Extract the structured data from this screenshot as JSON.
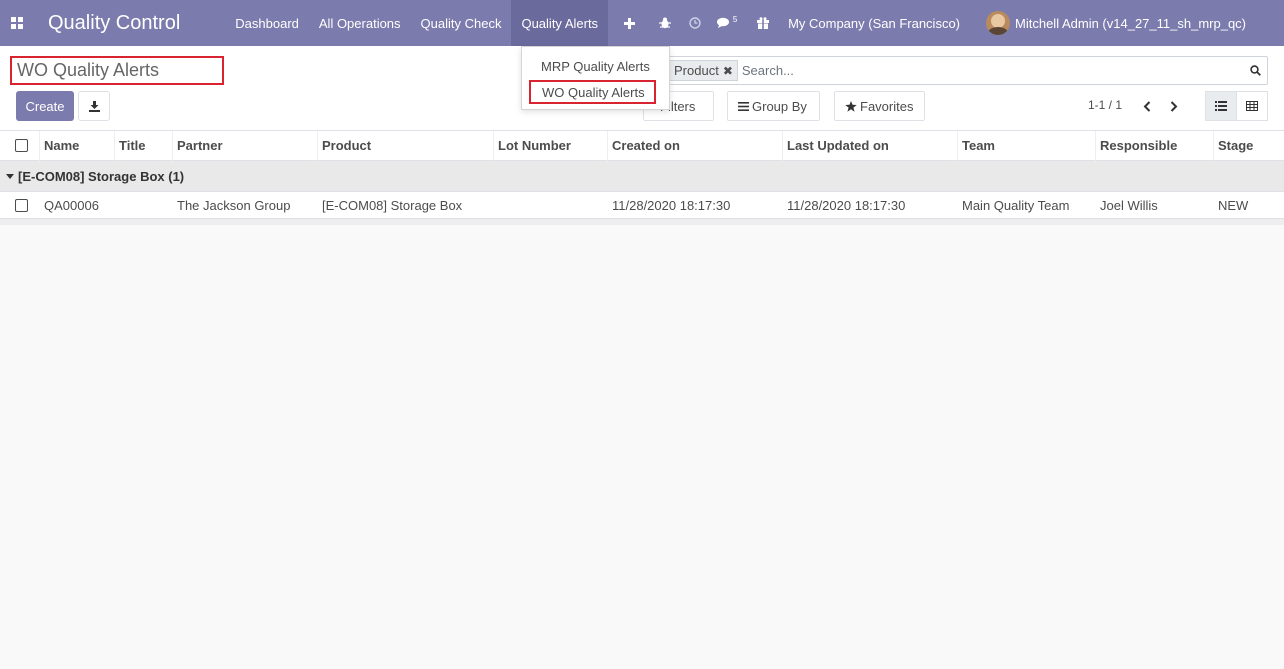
{
  "navbar": {
    "app_title": "Quality Control",
    "menu": [
      {
        "label": "Dashboard"
      },
      {
        "label": "All Operations"
      },
      {
        "label": "Quality Check"
      },
      {
        "label": "Quality Alerts"
      }
    ],
    "messages_count": "5",
    "company": "My Company (San Francisco)",
    "user": "Mitchell Admin (v14_27_11_sh_mrp_qc)",
    "bg_color": "#7c7bad"
  },
  "dropdown": {
    "items": [
      {
        "label": "MRP Quality Alerts"
      },
      {
        "label": "WO Quality Alerts"
      }
    ]
  },
  "control_panel": {
    "breadcrumb": "WO Quality Alerts",
    "create_label": "Create",
    "facet_label": "Product",
    "search_placeholder": "Search...",
    "filters_label": "Filters",
    "groupby_label": "Group By",
    "favorites_label": "Favorites",
    "pager": "1-1 / 1"
  },
  "table": {
    "columns": [
      "Name",
      "Title",
      "Partner",
      "Product",
      "Lot Number",
      "Created on",
      "Last Updated on",
      "Team",
      "Responsible",
      "Stage"
    ],
    "group": {
      "label": "[E-COM08] Storage Box (1)"
    },
    "rows": [
      {
        "name": "QA00006",
        "title": "",
        "partner": "The Jackson Group",
        "product": "[E-COM08] Storage Box",
        "lot": "",
        "created": "11/28/2020 18:17:30",
        "updated": "11/28/2020 18:17:30",
        "team": "Main Quality Team",
        "responsible": "Joel Willis",
        "stage": "NEW"
      }
    ]
  },
  "colors": {
    "accent": "#7c7bad",
    "highlight_box": "#d9232f"
  }
}
